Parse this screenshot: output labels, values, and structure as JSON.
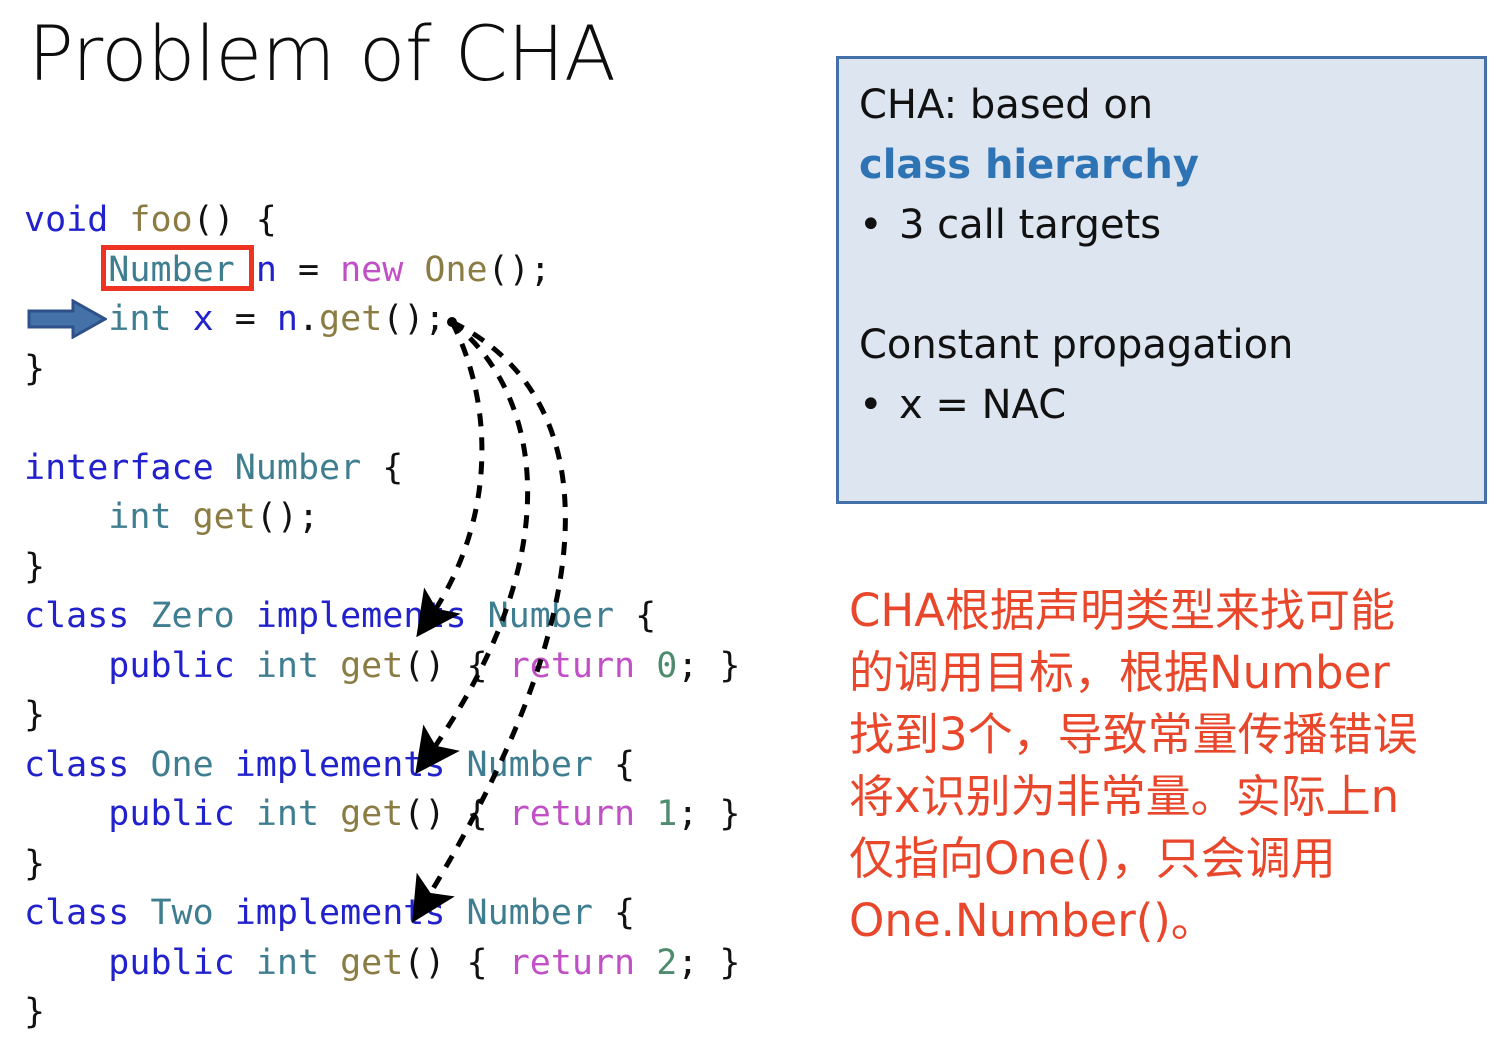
{
  "slide": {
    "title": "Problem of CHA"
  },
  "code": {
    "language": "java",
    "lines": [
      [
        {
          "t": "void",
          "c": "k"
        },
        {
          "t": " ",
          "c": "pn"
        },
        {
          "t": "foo",
          "c": "fn"
        },
        {
          "t": "() {",
          "c": "pn"
        }
      ],
      [
        {
          "t": "    ",
          "c": "pn"
        },
        {
          "t": "Number",
          "c": "ty"
        },
        {
          "t": " ",
          "c": "pn"
        },
        {
          "t": "n",
          "c": "var"
        },
        {
          "t": " = ",
          "c": "pn"
        },
        {
          "t": "new",
          "c": "mag"
        },
        {
          "t": " ",
          "c": "pn"
        },
        {
          "t": "One",
          "c": "fn"
        },
        {
          "t": "();",
          "c": "pn"
        }
      ],
      [
        {
          "t": "    ",
          "c": "pn"
        },
        {
          "t": "int",
          "c": "ty"
        },
        {
          "t": " ",
          "c": "pn"
        },
        {
          "t": "x",
          "c": "var"
        },
        {
          "t": " = ",
          "c": "pn"
        },
        {
          "t": "n",
          "c": "var"
        },
        {
          "t": ".",
          "c": "pn"
        },
        {
          "t": "get",
          "c": "fn"
        },
        {
          "t": "();",
          "c": "pn"
        }
      ],
      [
        {
          "t": "}",
          "c": "pn"
        }
      ],
      [],
      [
        {
          "t": "interface",
          "c": "k"
        },
        {
          "t": " ",
          "c": "pn"
        },
        {
          "t": "Number",
          "c": "ty"
        },
        {
          "t": " {",
          "c": "pn"
        }
      ],
      [
        {
          "t": "    ",
          "c": "pn"
        },
        {
          "t": "int",
          "c": "ty"
        },
        {
          "t": " ",
          "c": "pn"
        },
        {
          "t": "get",
          "c": "fn"
        },
        {
          "t": "();",
          "c": "pn"
        }
      ],
      [
        {
          "t": "}",
          "c": "pn"
        }
      ],
      [
        {
          "t": "class",
          "c": "k"
        },
        {
          "t": " ",
          "c": "pn"
        },
        {
          "t": "Zero",
          "c": "ty"
        },
        {
          "t": " ",
          "c": "pn"
        },
        {
          "t": "implements",
          "c": "k"
        },
        {
          "t": " ",
          "c": "pn"
        },
        {
          "t": "Number",
          "c": "ty"
        },
        {
          "t": " {",
          "c": "pn"
        }
      ],
      [
        {
          "t": "    ",
          "c": "pn"
        },
        {
          "t": "public",
          "c": "k"
        },
        {
          "t": " ",
          "c": "pn"
        },
        {
          "t": "int",
          "c": "ty"
        },
        {
          "t": " ",
          "c": "pn"
        },
        {
          "t": "get",
          "c": "fn"
        },
        {
          "t": "() { ",
          "c": "pn"
        },
        {
          "t": "return",
          "c": "mag"
        },
        {
          "t": " ",
          "c": "pn"
        },
        {
          "t": "0",
          "c": "num"
        },
        {
          "t": "; }",
          "c": "pn"
        }
      ],
      [
        {
          "t": "}",
          "c": "pn"
        }
      ],
      [
        {
          "t": "class",
          "c": "k"
        },
        {
          "t": " ",
          "c": "pn"
        },
        {
          "t": "One",
          "c": "ty"
        },
        {
          "t": " ",
          "c": "pn"
        },
        {
          "t": "implements",
          "c": "k"
        },
        {
          "t": " ",
          "c": "pn"
        },
        {
          "t": "Number",
          "c": "ty"
        },
        {
          "t": " {",
          "c": "pn"
        }
      ],
      [
        {
          "t": "    ",
          "c": "pn"
        },
        {
          "t": "public",
          "c": "k"
        },
        {
          "t": " ",
          "c": "pn"
        },
        {
          "t": "int",
          "c": "ty"
        },
        {
          "t": " ",
          "c": "pn"
        },
        {
          "t": "get",
          "c": "fn"
        },
        {
          "t": "() { ",
          "c": "pn"
        },
        {
          "t": "return",
          "c": "mag"
        },
        {
          "t": " ",
          "c": "pn"
        },
        {
          "t": "1",
          "c": "num"
        },
        {
          "t": "; }",
          "c": "pn"
        }
      ],
      [
        {
          "t": "}",
          "c": "pn"
        }
      ],
      [
        {
          "t": "class",
          "c": "k"
        },
        {
          "t": " ",
          "c": "pn"
        },
        {
          "t": "Two",
          "c": "ty"
        },
        {
          "t": " ",
          "c": "pn"
        },
        {
          "t": "implements",
          "c": "k"
        },
        {
          "t": " ",
          "c": "pn"
        },
        {
          "t": "Number",
          "c": "ty"
        },
        {
          "t": " {",
          "c": "pn"
        }
      ],
      [
        {
          "t": "    ",
          "c": "pn"
        },
        {
          "t": "public",
          "c": "k"
        },
        {
          "t": " ",
          "c": "pn"
        },
        {
          "t": "int",
          "c": "ty"
        },
        {
          "t": " ",
          "c": "pn"
        },
        {
          "t": "get",
          "c": "fn"
        },
        {
          "t": "() { ",
          "c": "pn"
        },
        {
          "t": "return",
          "c": "mag"
        },
        {
          "t": " ",
          "c": "pn"
        },
        {
          "t": "2",
          "c": "num"
        },
        {
          "t": "; }",
          "c": "pn"
        }
      ],
      [
        {
          "t": "}",
          "c": "pn"
        }
      ]
    ]
  },
  "annotations": {
    "declared_type_box_label": "Number",
    "current_line_marker_label": "int x = n.get();",
    "call_edge_count": 3,
    "call_edge_targets": [
      "Zero.get()",
      "One.get()",
      "Two.get()"
    ]
  },
  "info_box": {
    "heading": "CHA: based on",
    "accent": "class hierarchy",
    "bullet_1": "3 call targets",
    "subheading": "Constant propagation",
    "bullet_2": "x = NAC",
    "bullet_glyph": "•"
  },
  "cn_note": {
    "lines": [
      "CHA根据声明类型来找可能",
      "的调用目标，根据Number",
      "找到3个，导致常量传播错误",
      "将x识别为非常量。实际上n",
      "仅指向One()，只会调用",
      "One.Number()。"
    ]
  },
  "colors": {
    "title": "#0d0d0d",
    "info_box_fill": "#dce5f0",
    "info_box_border": "#4472a8",
    "info_box_accent": "#2e74b5",
    "cn_note": "#e8472b",
    "highlight_box": "#ee3322",
    "marker_arrow_fill": "#4472a8",
    "marker_arrow_stroke": "#2e5189",
    "code_keyword": "#2222cc",
    "code_type": "#3f7e91",
    "code_method": "#8a7c43",
    "code_literal_kw": "#c14fc6",
    "code_number": "#4f8c6d",
    "code_punct": "#111111",
    "call_edge": "#000000"
  }
}
